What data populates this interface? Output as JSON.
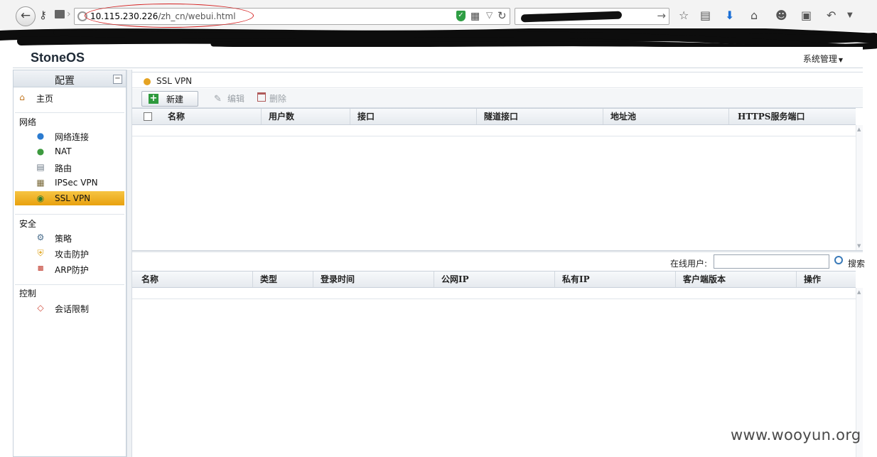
{
  "browser": {
    "url_host": "10.115.230.226",
    "url_path": "/zh_cn/webui.html"
  },
  "app": {
    "title": "StoneOS",
    "system_menu_label": "系统管理"
  },
  "sidebar": {
    "title": "配置",
    "home_label": "主页",
    "groups": [
      {
        "label": "网络",
        "items": [
          {
            "label": "网络连接",
            "icon": "globe-icon"
          },
          {
            "label": "NAT",
            "icon": "nat-globe-icon"
          },
          {
            "label": "路由",
            "icon": "router-icon"
          },
          {
            "label": "IPSec VPN",
            "icon": "ipsec-icon"
          },
          {
            "label": "SSL VPN",
            "icon": "sslvpn-icon",
            "selected": true
          }
        ]
      },
      {
        "label": "安全",
        "items": [
          {
            "label": "策略",
            "icon": "policy-icon"
          },
          {
            "label": "攻击防护",
            "icon": "shield-icon"
          },
          {
            "label": "ARP防护",
            "icon": "arp-icon"
          }
        ]
      },
      {
        "label": "控制",
        "items": [
          {
            "label": "会话限制",
            "icon": "session-limit-icon"
          }
        ]
      }
    ]
  },
  "panel": {
    "title": "SSL VPN",
    "toolbar": {
      "new_label": "新建",
      "edit_label": "编辑",
      "delete_label": "删除"
    },
    "upper_grid": {
      "columns": [
        "名称",
        "用户数",
        "接口",
        "隧道接口",
        "地址池",
        "HTTPS服务端口"
      ]
    },
    "online": {
      "label": "在线用户:",
      "search_value": "",
      "search_label": "搜索"
    },
    "lower_grid": {
      "columns": [
        "名称",
        "类型",
        "登录时间",
        "公网IP",
        "私有IP",
        "客户端版本",
        "操作"
      ]
    }
  },
  "watermark": "www.wooyun.org",
  "colors": {
    "selected_row": "#f0b42a",
    "title_dot": "#e5a323",
    "annotation_circle": "#d42020"
  }
}
